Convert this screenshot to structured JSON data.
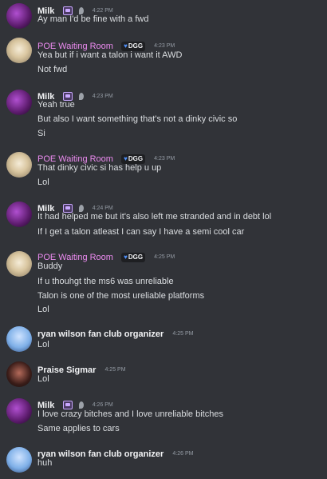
{
  "messages": [
    {
      "author": "Milk",
      "time": "4:22 PM",
      "lines": [
        "Ay man I'd be fine with a fwd"
      ]
    },
    {
      "author": "POE Waiting Room",
      "badge": "DGG",
      "time": "4:23 PM",
      "lines": [
        "Yea but if i want a talon i want it AWD",
        "Not fwd"
      ]
    },
    {
      "author": "Milk",
      "time": "4:23 PM",
      "lines": [
        "Yeah true",
        "But also I want something that's not a dinky civic so",
        "Si"
      ]
    },
    {
      "author": "POE Waiting Room",
      "badge": "DGG",
      "time": "4:23 PM",
      "lines": [
        "That dinky civic si has help u up",
        "Lol"
      ]
    },
    {
      "author": "Milk",
      "time": "4:24 PM",
      "lines": [
        "It had helped me but it's also left me stranded and in debt lol",
        "If I get a talon atleast I can say I have a semi cool car"
      ]
    },
    {
      "author": "POE Waiting Room",
      "badge": "DGG",
      "time": "4:25 PM",
      "lines": [
        "Buddy",
        "If u thouhgt the ms6 was unreliable",
        "Talon is one of the most ureliable platforms",
        "Lol"
      ]
    },
    {
      "author": "ryan wilson fan club organizer",
      "time": "4:25 PM",
      "lines": [
        "Lol"
      ]
    },
    {
      "author": "Praise Sigmar",
      "time": "4:25 PM",
      "lines": [
        "Lol"
      ]
    },
    {
      "author": "Milk",
      "time": "4:26 PM",
      "lines": [
        "I love crazy bitches and I love unreliable bitches",
        "Same applies to cars"
      ]
    },
    {
      "author": "ryan wilson fan club organizer",
      "time": "4:26 PM",
      "lines": [
        "huh"
      ]
    }
  ],
  "colors": {
    "background": "#313338",
    "text": "#dbdee1",
    "timestamp": "#949ba4",
    "poe_name": "#ec8bf0"
  }
}
